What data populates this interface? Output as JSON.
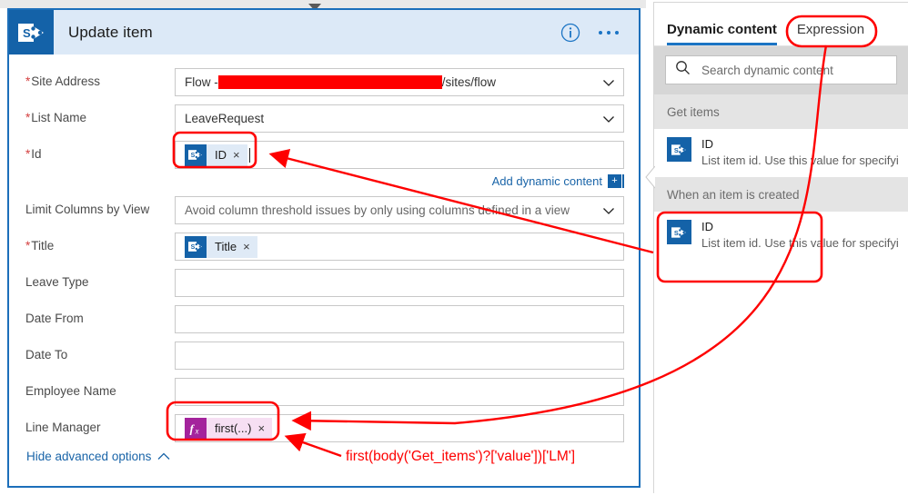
{
  "card": {
    "title": "Update item",
    "icon": "sharepoint-icon",
    "info_icon": "info-icon",
    "more_icon": "ellipsis-icon",
    "collapse_chevron": "chevron-down-icon"
  },
  "fields": [
    {
      "label": "Site Address",
      "required": true,
      "kind": "dropdown",
      "value_prefix": "Flow -",
      "redacted": true,
      "value_suffix": "/sites/flow",
      "chevron": "chevron-down-icon"
    },
    {
      "label": "List Name",
      "required": true,
      "kind": "dropdown",
      "value": "LeaveRequest",
      "chevron": "chevron-down-icon"
    },
    {
      "label": "Id",
      "required": true,
      "kind": "token",
      "token": {
        "text": "ID",
        "icon": "sharepoint-icon",
        "remove": "×",
        "type": "dynamic"
      },
      "highlighted": true
    },
    {
      "label": "Limit Columns by View",
      "required": false,
      "kind": "dropdown",
      "value": "Avoid column threshold issues by only using columns defined in a view",
      "chevron": "chevron-down-icon"
    },
    {
      "label": "Title",
      "required": true,
      "kind": "token",
      "token": {
        "text": "Title",
        "icon": "sharepoint-icon",
        "remove": "×",
        "type": "dynamic"
      }
    },
    {
      "label": "Leave Type",
      "required": false,
      "kind": "text",
      "value": ""
    },
    {
      "label": "Date From",
      "required": false,
      "kind": "text",
      "value": ""
    },
    {
      "label": "Date To",
      "required": false,
      "kind": "text",
      "value": ""
    },
    {
      "label": "Employee Name",
      "required": false,
      "kind": "text",
      "value": ""
    },
    {
      "label": "Line Manager",
      "required": false,
      "kind": "token",
      "token": {
        "text": "first(...)",
        "icon": "function-fx-icon",
        "remove": "×",
        "type": "expression"
      },
      "highlighted": true
    }
  ],
  "add_dynamic_content": {
    "label": "Add dynamic content",
    "plus": "+"
  },
  "hide_advanced": {
    "label": "Hide advanced options",
    "chevron": "chevron-up-icon"
  },
  "panel": {
    "tabs": [
      {
        "label": "Dynamic content",
        "active": true
      },
      {
        "label": "Expression",
        "active": false,
        "highlighted": true
      }
    ],
    "search": {
      "placeholder": "Search dynamic content",
      "icon": "search-icon"
    },
    "groups": [
      {
        "name": "Get items",
        "items": [
          {
            "title": "ID",
            "description": "List item id. Use this value for specifyi",
            "icon": "sharepoint-icon"
          }
        ]
      },
      {
        "name": "When an item is created",
        "highlighted": true,
        "items": [
          {
            "title": "ID",
            "description": "List item id. Use this value for specifyi",
            "icon": "sharepoint-icon"
          }
        ]
      }
    ],
    "collapse_handle": "panel-collapse-handle"
  },
  "annotation": {
    "expression_text": "first(body('Get_items')?['value'])['LM']",
    "color": "#fe0000"
  },
  "colors": {
    "accent_blue": "#1b74c4",
    "sharepoint_blue": "#1462a8",
    "card_header": "#dce9f7",
    "annotation_red": "#fe0000",
    "expression_magenta": "#a4239c"
  }
}
